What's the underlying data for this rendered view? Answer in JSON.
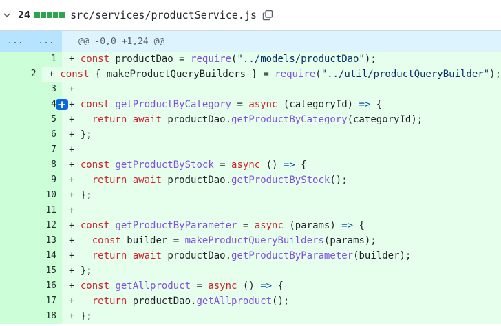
{
  "file": {
    "additions": "24",
    "path": "src/services/productService.js",
    "bar_color": "#2da44e"
  },
  "hunk": {
    "old_marker": "...",
    "new_marker": "...",
    "header": "@@ -0,0 +1,24 @@"
  },
  "lines": [
    {
      "num": "1",
      "tokens": [
        [
          "p",
          "+ "
        ],
        [
          "kw",
          "const"
        ],
        [
          "p",
          " productDao = "
        ],
        [
          "fn",
          "require"
        ],
        [
          "p",
          "("
        ],
        [
          "str",
          "\"../models/productDao\""
        ],
        [
          "p",
          ");"
        ]
      ]
    },
    {
      "num": "2",
      "tokens": [
        [
          "p",
          "+ "
        ],
        [
          "kw",
          "const"
        ],
        [
          "p",
          " { makeProductQueryBuilders } = "
        ],
        [
          "fn",
          "require"
        ],
        [
          "p",
          "("
        ],
        [
          "str",
          "\"../util/productQueryBuilder\""
        ],
        [
          "p",
          ");"
        ]
      ]
    },
    {
      "num": "3",
      "tokens": [
        [
          "p",
          "+"
        ]
      ]
    },
    {
      "num": "4",
      "tokens": [
        [
          "p",
          "+ "
        ],
        [
          "kw",
          "const"
        ],
        [
          "p",
          " "
        ],
        [
          "fn",
          "getProductByCategory"
        ],
        [
          "p",
          " = "
        ],
        [
          "kw",
          "async"
        ],
        [
          "p",
          " (categoryId) "
        ],
        [
          "op",
          "=>"
        ],
        [
          "p",
          " {"
        ]
      ]
    },
    {
      "num": "5",
      "tokens": [
        [
          "p",
          "+   "
        ],
        [
          "kw",
          "return"
        ],
        [
          "p",
          " "
        ],
        [
          "kw",
          "await"
        ],
        [
          "p",
          " productDao."
        ],
        [
          "fn",
          "getProductByCategory"
        ],
        [
          "p",
          "(categoryId);"
        ]
      ]
    },
    {
      "num": "6",
      "tokens": [
        [
          "p",
          "+ };"
        ]
      ]
    },
    {
      "num": "7",
      "tokens": [
        [
          "p",
          "+"
        ]
      ]
    },
    {
      "num": "8",
      "tokens": [
        [
          "p",
          "+ "
        ],
        [
          "kw",
          "const"
        ],
        [
          "p",
          " "
        ],
        [
          "fn",
          "getProductByStock"
        ],
        [
          "p",
          " = "
        ],
        [
          "kw",
          "async"
        ],
        [
          "p",
          " () "
        ],
        [
          "op",
          "=>"
        ],
        [
          "p",
          " {"
        ]
      ]
    },
    {
      "num": "9",
      "tokens": [
        [
          "p",
          "+   "
        ],
        [
          "kw",
          "return"
        ],
        [
          "p",
          " "
        ],
        [
          "kw",
          "await"
        ],
        [
          "p",
          " productDao."
        ],
        [
          "fn",
          "getProductByStock"
        ],
        [
          "p",
          "();"
        ]
      ]
    },
    {
      "num": "10",
      "tokens": [
        [
          "p",
          "+ };"
        ]
      ]
    },
    {
      "num": "11",
      "tokens": [
        [
          "p",
          "+"
        ]
      ]
    },
    {
      "num": "12",
      "tokens": [
        [
          "p",
          "+ "
        ],
        [
          "kw",
          "const"
        ],
        [
          "p",
          " "
        ],
        [
          "fn",
          "getProductByParameter"
        ],
        [
          "p",
          " = "
        ],
        [
          "kw",
          "async"
        ],
        [
          "p",
          " (params) "
        ],
        [
          "op",
          "=>"
        ],
        [
          "p",
          " {"
        ]
      ]
    },
    {
      "num": "13",
      "tokens": [
        [
          "p",
          "+   "
        ],
        [
          "kw",
          "const"
        ],
        [
          "p",
          " builder = "
        ],
        [
          "fn",
          "makeProductQueryBuilders"
        ],
        [
          "p",
          "(params);"
        ]
      ]
    },
    {
      "num": "14",
      "tokens": [
        [
          "p",
          "+   "
        ],
        [
          "kw",
          "return"
        ],
        [
          "p",
          " "
        ],
        [
          "kw",
          "await"
        ],
        [
          "p",
          " productDao."
        ],
        [
          "fn",
          "getProductByParameter"
        ],
        [
          "p",
          "(builder);"
        ]
      ]
    },
    {
      "num": "15",
      "tokens": [
        [
          "p",
          "+ };"
        ]
      ]
    },
    {
      "num": "16",
      "tokens": [
        [
          "p",
          "+ "
        ],
        [
          "kw",
          "const"
        ],
        [
          "p",
          " "
        ],
        [
          "fn",
          "getAllproduct"
        ],
        [
          "p",
          " = "
        ],
        [
          "kw",
          "async"
        ],
        [
          "p",
          " () "
        ],
        [
          "op",
          "=>"
        ],
        [
          "p",
          " {"
        ]
      ]
    },
    {
      "num": "17",
      "tokens": [
        [
          "p",
          "+   "
        ],
        [
          "kw",
          "return"
        ],
        [
          "p",
          " productDao."
        ],
        [
          "fn",
          "getAllproduct"
        ],
        [
          "p",
          "();"
        ]
      ]
    },
    {
      "num": "18",
      "tokens": [
        [
          "p",
          "+ };"
        ]
      ]
    }
  ],
  "add_comment_icon": "plus-icon",
  "add_comment_row": 4,
  "add_comment_glyph": "+"
}
